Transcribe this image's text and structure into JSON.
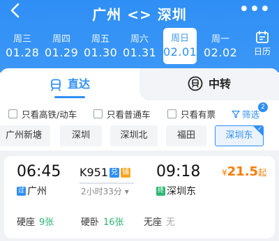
{
  "header": {
    "title": "广州 <> 深圳",
    "more_label": "•••"
  },
  "dates": [
    {
      "weekday": "周三",
      "date": "01.28"
    },
    {
      "weekday": "周四",
      "date": "01.29"
    },
    {
      "weekday": "周五",
      "date": "01.30"
    },
    {
      "weekday": "周六",
      "date": "01.31"
    },
    {
      "weekday": "周日",
      "date": "02.01",
      "selected": true
    },
    {
      "weekday": "周一",
      "date": "02.02"
    }
  ],
  "calendar_label": "日历",
  "tabs": {
    "direct": "直达",
    "transfer": "中转"
  },
  "filters": {
    "high_speed": "只看高铁/动车",
    "regular": "只看普通车",
    "available": "只看有票",
    "filter_label": "筛选",
    "filter_count": "2"
  },
  "stations": [
    "广州新塘",
    "深圳",
    "深圳北",
    "福田",
    "深圳东"
  ],
  "selected_station": "深圳东",
  "train": {
    "dep_time": "06:45",
    "arr_time": "09:18",
    "train_no": "K951",
    "badge_1": "兑",
    "badge_2": "铺",
    "duration": "2小时33分",
    "dep_tag": "过",
    "arr_tag": "终",
    "dep_station": "广州",
    "arr_station": "深圳东",
    "price_symbol": "¥",
    "price": "21.5",
    "price_suffix": "起",
    "seats": [
      {
        "type": "硬座",
        "count": "9张"
      },
      {
        "type": "硬卧",
        "count": "16张"
      },
      {
        "type": "无座",
        "count": "无"
      }
    ]
  },
  "colors": {
    "primary": "#2f8ff5",
    "price": "#ff7a00",
    "available": "#2bb673"
  }
}
